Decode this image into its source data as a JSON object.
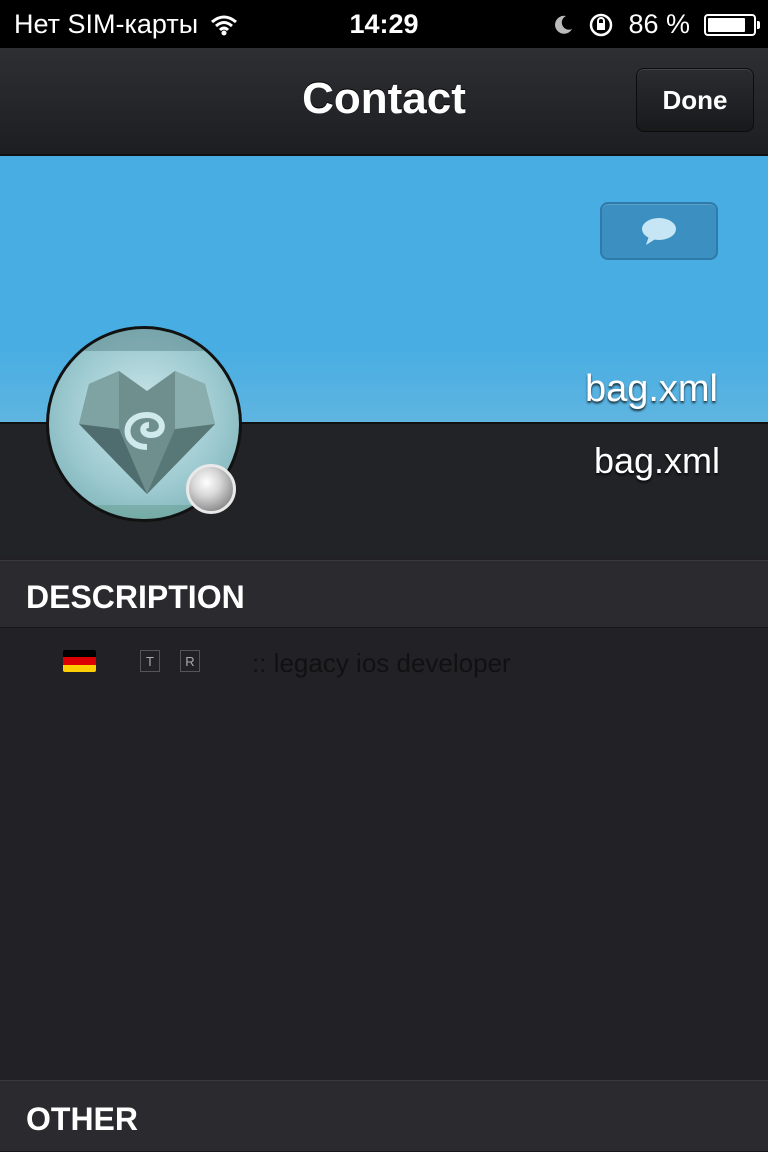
{
  "status_bar": {
    "carrier": "Нет SIM-карты",
    "time": "14:29",
    "battery": "86 %",
    "battery_level": 0.86
  },
  "nav": {
    "title": "Contact",
    "done_label": "Done"
  },
  "header": {
    "name_primary": "bag.xml",
    "name_secondary": "bag.xml",
    "accent_color": "#48ade2"
  },
  "sections": {
    "description_title": "DESCRIPTION",
    "other_title": "OTHER"
  },
  "description": {
    "flag_icon": "germany-flag-icon",
    "tag_t": "T",
    "tag_r": "R",
    "text": ":: legacy ios developer"
  }
}
